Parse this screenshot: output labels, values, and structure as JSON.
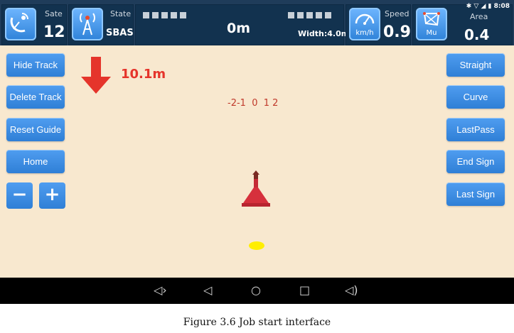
{
  "topbar": {
    "sate_label": "Sate",
    "sate_value": "12",
    "state_label": "State",
    "state_value": "SBAS",
    "distance_value": "0m",
    "width_text": "Width:4.0m",
    "speed_label": "Speed",
    "speed_unit": "km/h",
    "speed_value": "0.9",
    "area_label": "Area",
    "area_unit": "Mu",
    "area_value": "0.4",
    "clock": "8:08"
  },
  "left_buttons": {
    "hide_track": "Hide Track",
    "delete_track": "Delete Track",
    "reset_guide": "Reset Guide",
    "home": "Home",
    "zoom_out": "−",
    "zoom_in": "+"
  },
  "right_buttons": {
    "straight": "Straight",
    "curve": "Curve",
    "lastpass": "LastPass",
    "end_sign": "End Sign",
    "last_sign": "Last Sign"
  },
  "map": {
    "offset_value": "10.1m",
    "scale_ticks": "-2-1  0  1 2"
  },
  "caption": "Figure 3.6 Job start interface",
  "colors": {
    "map_bg": "#f8e8cf",
    "button_blue": "#3a8ee6",
    "arrow_red": "#e5342b",
    "offset_text": "#e5342b",
    "tractor_red": "#d6303c",
    "marker_yellow": "#ffee00"
  }
}
